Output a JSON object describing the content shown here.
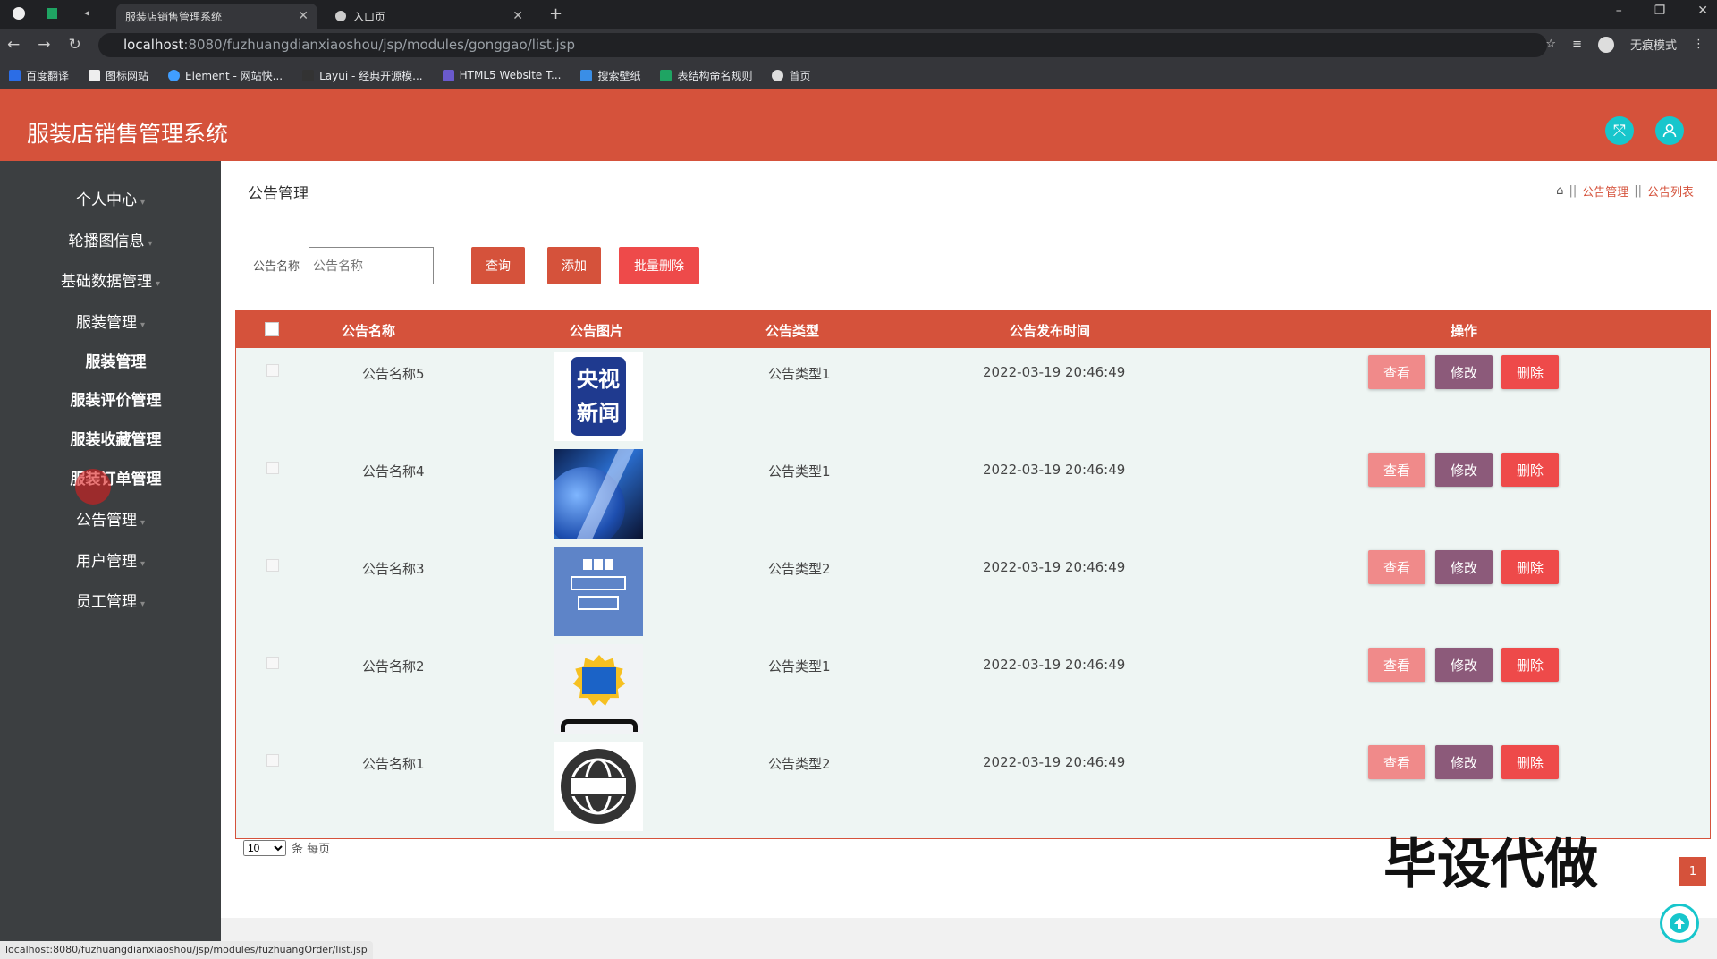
{
  "browser": {
    "tabs": [
      {
        "label": "服装店销售管理系统",
        "active": true
      },
      {
        "label": "入口页",
        "active": false
      }
    ],
    "url_host": "localhost",
    "url_rest": ":8080/fuzhuangdianxiaoshou/jsp/modules/gonggao/list.jsp",
    "incognito_label": "无痕模式",
    "bookmarks": [
      "百度翻译",
      "图标网站",
      "Element - 网站快...",
      "Layui - 经典开源模...",
      "HTML5 Website T...",
      "搜索壁纸",
      "表结构命名规则",
      "首页"
    ],
    "status_url": "localhost:8080/fuzhuangdianxiaoshou/jsp/modules/fuzhuangOrder/list.jsp"
  },
  "app": {
    "title": "服装店销售管理系统"
  },
  "sidebar": {
    "items": [
      {
        "label": "个人中心"
      },
      {
        "label": "轮播图信息"
      },
      {
        "label": "基础数据管理"
      },
      {
        "label": "服装管理"
      },
      {
        "label": "服装管理"
      },
      {
        "label": "服装评价管理"
      },
      {
        "label": "服装收藏管理"
      },
      {
        "label": "服装订单管理"
      },
      {
        "label": "公告管理"
      },
      {
        "label": "用户管理"
      },
      {
        "label": "员工管理"
      }
    ]
  },
  "main": {
    "page_title": "公告管理",
    "breadcrumb": [
      "公告管理",
      "公告列表"
    ],
    "breadcrumb_sep": "||",
    "search": {
      "label": "公告名称",
      "placeholder": "公告名称",
      "value": ""
    },
    "buttons": {
      "query": "查询",
      "add": "添加",
      "batch_delete": "批量删除"
    },
    "table": {
      "headers": [
        "公告名称",
        "公告图片",
        "公告类型",
        "公告发布时间",
        "操作"
      ],
      "rows": [
        {
          "name": "公告名称5",
          "type": "公告类型1",
          "time": "2022-03-19 20:46:49",
          "image": "cctv-news-logo"
        },
        {
          "name": "公告名称4",
          "type": "公告类型1",
          "time": "2022-03-19 20:46:49",
          "image": "globe-news-image"
        },
        {
          "name": "公告名称3",
          "type": "公告类型2",
          "time": "2022-03-19 20:46:49",
          "image": "bbc-world-news-logo"
        },
        {
          "name": "公告名称2",
          "type": "公告类型1",
          "time": "2022-03-19 20:46:49",
          "image": "baodian-news-logo"
        },
        {
          "name": "公告名称1",
          "type": "公告类型2",
          "time": "2022-03-19 20:46:49",
          "image": "news-globe-icon"
        }
      ],
      "action_labels": {
        "view": "查看",
        "edit": "修改",
        "delete": "删除"
      }
    },
    "pager": {
      "page_size": "10",
      "suffix": "条 每页",
      "current_page": "1"
    },
    "watermark": "毕设代做"
  },
  "colors": {
    "accent": "#d5523b",
    "sidebar": "#3c3f41",
    "teal": "#17c6cc",
    "row_bg": "#eef5f3"
  }
}
